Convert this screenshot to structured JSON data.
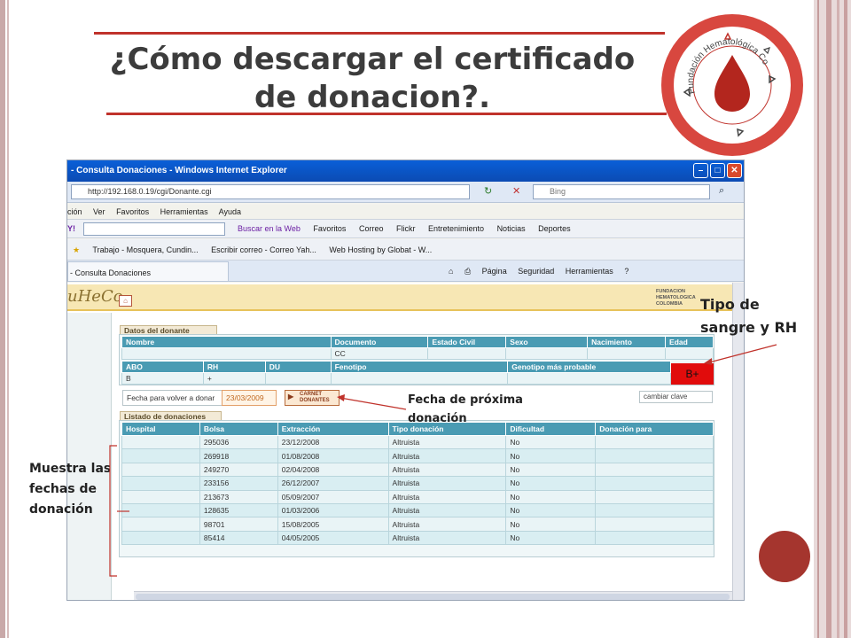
{
  "slide": {
    "title_line1": "¿Cómo descargar el certificado",
    "title_line2": "de donacion?.",
    "logo_text": "Fundación Hematológica Colombia",
    "colors": {
      "accent_red": "#c0322b",
      "text_dark": "#3c3c3c",
      "dot": "#a5352e"
    }
  },
  "annotations": {
    "tipo_sangre": "Tipo de sangre y RH",
    "fecha_proxima": "Fecha de próxima donación",
    "muestra_fechas": "Muestra las fechas de donación"
  },
  "browser": {
    "window_title": "- Consulta Donaciones - Windows Internet Explorer",
    "address": "http://192.168.0.19/cgi/Donante.cgi",
    "search_placeholder": "Bing",
    "menu": [
      "ción",
      "Ver",
      "Favoritos",
      "Herramientas",
      "Ayuda"
    ],
    "toolbar": {
      "search_button": "Buscar en la Web",
      "items": [
        "Favoritos",
        "Correo",
        "Flickr",
        "Entretenimiento",
        "Noticias",
        "Deportes"
      ]
    },
    "favorites": [
      "Trabajo - Mosquera, Cundin...",
      "Escribir correo - Correo Yah...",
      "Web Hosting by Globat - W..."
    ],
    "tab_label": "- Consulta Donaciones",
    "commands": [
      "Página",
      "Seguridad",
      "Herramientas"
    ]
  },
  "app": {
    "brand": "uHeCo",
    "fundacion_lines": [
      "FUNDACION",
      "HEMATOLOGICA",
      "COLOMBIA"
    ],
    "donor_section": {
      "title": "Datos del donante",
      "headers1": [
        "Nombre",
        "Documento",
        "Estado Civil",
        "Sexo",
        "Nacimiento",
        "Edad"
      ],
      "row1": [
        "",
        "CC",
        "",
        "",
        "",
        ""
      ],
      "headers2": [
        "ABO",
        "RH",
        "DU",
        "Fenotipo",
        "Genotipo más probable"
      ],
      "row2": [
        "B",
        "+",
        "",
        "",
        ""
      ],
      "blood_type": "B+"
    },
    "fecha_label": "Fecha para volver a donar",
    "fecha_value": "23/03/2009",
    "carnet_label_1": "CARNET",
    "carnet_label_2": "DONANTES",
    "cambiar_clave": "cambiar clave",
    "donations": {
      "title": "Listado de donaciones",
      "headers": [
        "Hospital",
        "Bolsa",
        "Extracción",
        "Tipo donación",
        "Dificultad",
        "Donación para"
      ],
      "rows": [
        [
          "",
          "295036",
          "23/12/2008",
          "Altruista",
          "No",
          ""
        ],
        [
          "",
          "269918",
          "01/08/2008",
          "Altruista",
          "No",
          ""
        ],
        [
          "",
          "249270",
          "02/04/2008",
          "Altruista",
          "No",
          ""
        ],
        [
          "",
          "233156",
          "26/12/2007",
          "Altruista",
          "No",
          ""
        ],
        [
          "",
          "213673",
          "05/09/2007",
          "Altruista",
          "No",
          ""
        ],
        [
          "",
          "128635",
          "01/03/2006",
          "Altruista",
          "No",
          ""
        ],
        [
          "",
          "98701",
          "15/08/2005",
          "Altruista",
          "No",
          ""
        ],
        [
          "",
          "85414",
          "04/05/2005",
          "Altruista",
          "No",
          ""
        ]
      ]
    }
  }
}
